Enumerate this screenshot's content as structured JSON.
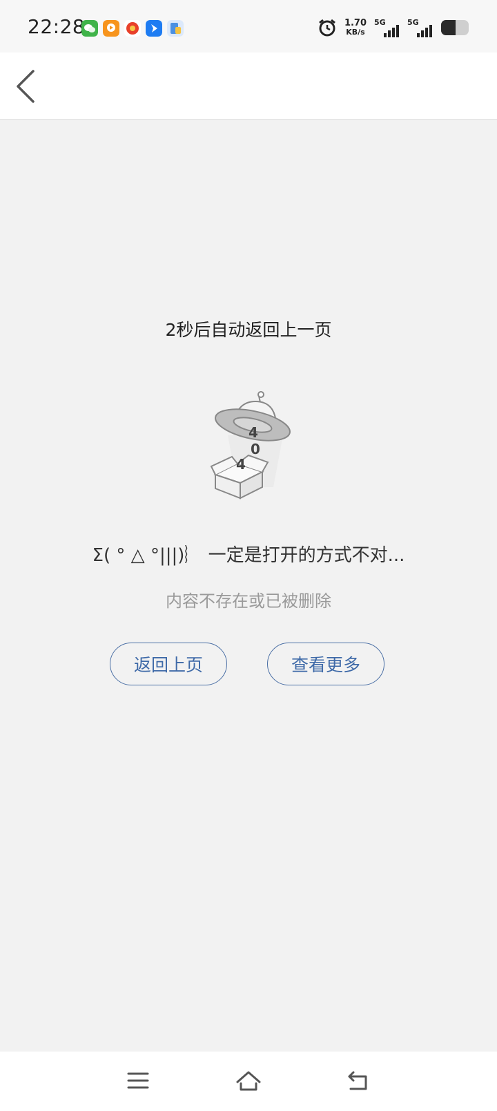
{
  "status_bar": {
    "time": "22:28",
    "notification_icons": [
      {
        "name": "wechat-icon",
        "color": "#3fb349"
      },
      {
        "name": "video-app-icon",
        "color": "#f7941d"
      },
      {
        "name": "shopping-app-icon",
        "color": "#e8402a"
      },
      {
        "name": "feishu-app-icon",
        "color": "#1e7cf2"
      },
      {
        "name": "files-app-icon",
        "color": "#4a90e2"
      }
    ],
    "net_speed": "1.70",
    "net_speed_unit": "KB/s",
    "signal1_label": "5G",
    "signal2_label": "5G"
  },
  "countdown_text": "2秒后自动返回上一页",
  "illustration_digits": [
    "4",
    "0",
    "4"
  ],
  "headline": "Σ( ° △ °|||)︴ 一定是打开的方式不对...",
  "subtext": "内容不存在或已被删除",
  "buttons": {
    "back_label": "返回上页",
    "more_label": "查看更多"
  },
  "colors": {
    "accent": "#4a6fa5",
    "background": "#f2f2f2"
  }
}
